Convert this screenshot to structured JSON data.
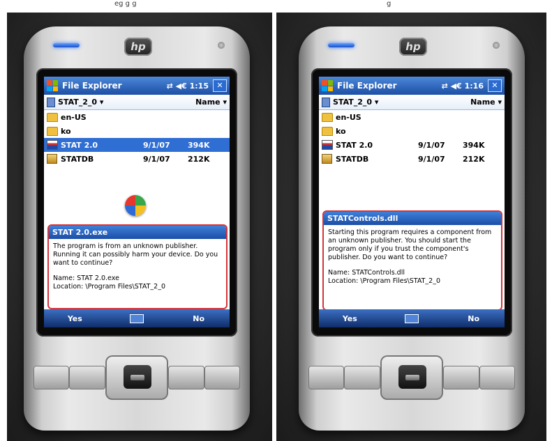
{
  "captions": {
    "left": "eg   g   g",
    "right": "g"
  },
  "brand": "hp",
  "devices": [
    {
      "window_title": "File Explorer",
      "status": "⇄ ◀€ 1:15",
      "close": "✕",
      "path": "STAT_2_0 ▾",
      "sort": "Name ▾",
      "files": [
        {
          "name": "en-US",
          "type": "folder",
          "date": "",
          "size": ""
        },
        {
          "name": "ko",
          "type": "folder",
          "date": "",
          "size": ""
        },
        {
          "name": "STAT 2.0",
          "type": "exe",
          "date": "9/1/07",
          "size": "394K",
          "selected": true
        },
        {
          "name": "STATDB",
          "type": "db",
          "date": "9/1/07",
          "size": "212K"
        }
      ],
      "dialog": {
        "title": "STAT 2.0.exe",
        "message": "The program is from an unknown publisher. Running it can possibly harm your device. Do you want to continue?",
        "name_line": "Name: STAT 2.0.exe",
        "location_line": "Location: \\Program Files\\STAT_2_0"
      },
      "softkeys": {
        "left": "Yes",
        "right": "No"
      }
    },
    {
      "window_title": "File Explorer",
      "status": "⇄ ◀€ 1:16",
      "close": "✕",
      "path": "STAT_2_0 ▾",
      "sort": "Name ▾",
      "files": [
        {
          "name": "en-US",
          "type": "folder",
          "date": "",
          "size": ""
        },
        {
          "name": "ko",
          "type": "folder",
          "date": "",
          "size": ""
        },
        {
          "name": "STAT 2.0",
          "type": "exe",
          "date": "9/1/07",
          "size": "394K"
        },
        {
          "name": "STATDB",
          "type": "db",
          "date": "9/1/07",
          "size": "212K"
        }
      ],
      "dialog": {
        "title": "STATControls.dll",
        "message": "Starting this program requires a component from an unknown publisher. You should start the program only if you trust the component's publisher. Do you want to continue?",
        "name_line": "Name: STATControls.dll",
        "location_line": "Location: \\Program Files\\STAT_2_0"
      },
      "softkeys": {
        "left": "Yes",
        "right": "No"
      }
    }
  ],
  "colors": {
    "titlebar": "#1d4fa6",
    "selection": "#2f6ed3",
    "dialog_border": "#d4343a"
  }
}
